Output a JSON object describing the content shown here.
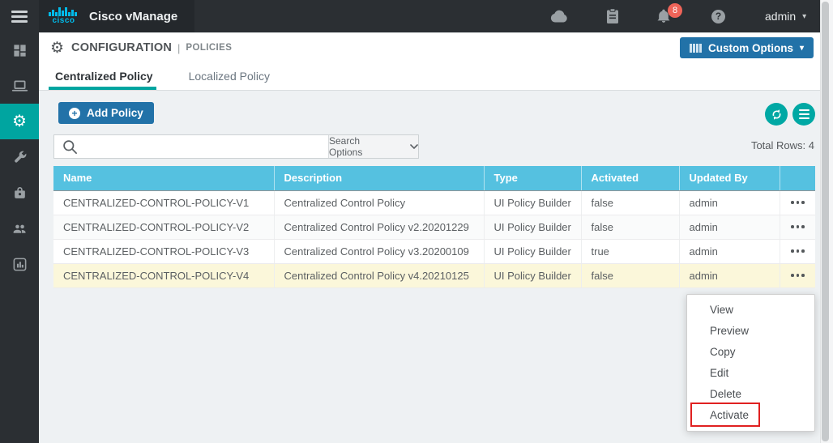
{
  "topbar": {
    "brand": "cisco",
    "product_name": "Cisco vManage",
    "notification_count": "8",
    "user_menu": {
      "label": "admin"
    },
    "icons": [
      "cloud-icon",
      "tasks-clipboard-icon",
      "bell-icon",
      "help-icon"
    ]
  },
  "sidebar": {
    "items": [
      {
        "icon": "dashboard-icon",
        "active": false
      },
      {
        "icon": "monitor-icon",
        "active": false
      },
      {
        "icon": "configuration-gear-icon",
        "active": true
      },
      {
        "icon": "tools-wrench-icon",
        "active": false
      },
      {
        "icon": "maintenance-bag-icon",
        "active": false
      },
      {
        "icon": "administration-users-icon",
        "active": false
      },
      {
        "icon": "analytics-chart-icon",
        "active": false
      }
    ]
  },
  "page_header": {
    "section": "CONFIGURATION",
    "divider": "|",
    "subsection": "POLICIES",
    "custom_options": {
      "label": "Custom Options",
      "icon": "columns-icon"
    }
  },
  "tabs": [
    {
      "label": "Centralized Policy",
      "active": true
    },
    {
      "label": "Localized Policy",
      "active": false
    }
  ],
  "toolbar": {
    "add_policy": {
      "label": "Add Policy",
      "icon": "plus-circle-icon"
    },
    "right_icons": [
      "refresh-icon",
      "list-menu-icon"
    ]
  },
  "search": {
    "icon": "search-icon",
    "value": "",
    "options_label": "Search Options"
  },
  "summary": {
    "total_rows": "Total Rows: 4"
  },
  "table": {
    "columns": [
      "Name",
      "Description",
      "Type",
      "Activated",
      "Updated By",
      ""
    ],
    "rows": [
      {
        "name": "CENTRALIZED-CONTROL-POLICY-V1",
        "description": "Centralized Control Policy",
        "type": "UI Policy Builder",
        "activated": "false",
        "updated_by": "admin"
      },
      {
        "name": "CENTRALIZED-CONTROL-POLICY-V2",
        "description": "Centralized Control Policy v2.20201229",
        "type": "UI Policy Builder",
        "activated": "false",
        "updated_by": "admin"
      },
      {
        "name": "CENTRALIZED-CONTROL-POLICY-V3",
        "description": "Centralized Control Policy v3.20200109",
        "type": "UI Policy Builder",
        "activated": "true",
        "updated_by": "admin"
      },
      {
        "name": "CENTRALIZED-CONTROL-POLICY-V4",
        "description": "Centralized Control Policy v4.20210125",
        "type": "UI Policy Builder",
        "activated": "false",
        "updated_by": "admin",
        "highlighted": true
      }
    ]
  },
  "context_menu": {
    "items": [
      "View",
      "Preview",
      "Copy",
      "Edit",
      "Delete",
      "Activate"
    ],
    "highlighted_item": "Activate"
  },
  "colors": {
    "topbar_bg": "#2b2f33",
    "logo_block_bg": "#24282c",
    "cisco_blue": "#00bceb",
    "teal_accent": "#00a5a0",
    "table_header_blue": "#55c1e0",
    "button_blue": "#2272a8",
    "row_highlight": "#fbf7da",
    "annotation_red": "#e02020",
    "badge_red": "#ef6459"
  }
}
